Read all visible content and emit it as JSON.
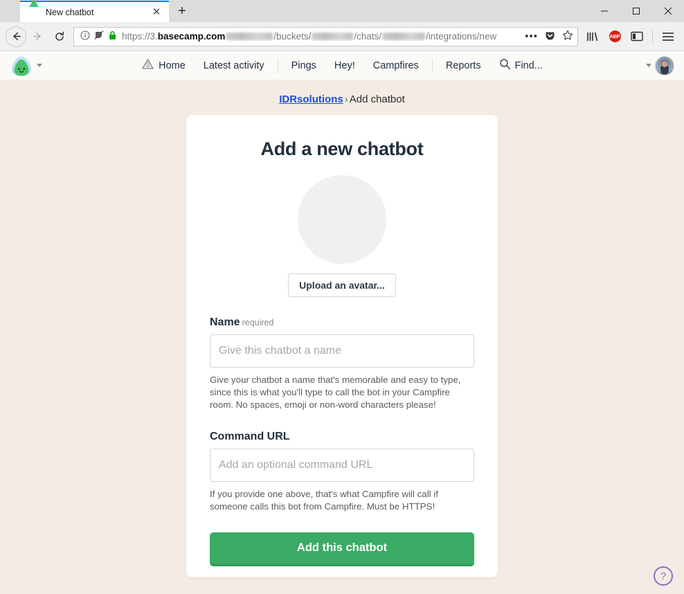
{
  "browser": {
    "tab": {
      "title": "New chatbot",
      "favicon": "basecamp-logo-icon",
      "close": "✕"
    },
    "new_tab_label": "+",
    "window_controls": {
      "minimize": "—",
      "maximize": "□",
      "close": "✕"
    },
    "nav": {
      "back": "←",
      "forward": "→",
      "reload": "↻"
    },
    "url": {
      "scheme": "https://3.",
      "domain": "basecamp.com",
      "path_1": "/buckets/",
      "path_2": "/chats/",
      "path_3": "/integrations/new",
      "icons": [
        "info-icon",
        "tracking-protection-icon",
        "lock-icon"
      ],
      "page_actions": "•••",
      "pocket": "pocket-icon",
      "bookmark": "star-icon"
    },
    "toolbar_icons": [
      "library-icon",
      "adblock-plus-icon",
      "sidebar-icon",
      "menu-icon"
    ],
    "adblock_label": "ABP"
  },
  "appnav": {
    "logo": "basecamp-logo-icon",
    "links": [
      {
        "label": "Home",
        "icon": "home-icon"
      },
      {
        "label": "Latest activity",
        "icon": ""
      },
      {
        "label": "Pings",
        "icon": ""
      },
      {
        "label": "Hey!",
        "icon": ""
      },
      {
        "label": "Campfires",
        "icon": ""
      },
      {
        "label": "Reports",
        "icon": ""
      },
      {
        "label": "Find...",
        "icon": "search-icon"
      }
    ],
    "account_avatar": "user-avatar"
  },
  "breadcrumb": {
    "project": "IDRsolutions",
    "separator": "›",
    "current": "Add chatbot"
  },
  "form": {
    "title": "Add a new chatbot",
    "avatar_placeholder": "empty-avatar",
    "upload_label": "Upload an avatar...",
    "fields": [
      {
        "label": "Name",
        "required_note": "required",
        "value": "",
        "placeholder": "Give this chatbot a name",
        "help": "Give your chatbot a name that's memorable and easy to type, since this is what you'll type to call the bot in your Campfire room. No spaces, emoji or non-word characters please!"
      },
      {
        "label": "Command URL",
        "required_note": "",
        "value": "",
        "placeholder": "Add an optional command URL",
        "help": "If you provide one above, that's what Campfire will call if someone calls this bot from Campfire. Must be HTTPS!"
      }
    ],
    "submit_label": "Add this chatbot"
  },
  "help_fab": {
    "label": "?"
  },
  "colors": {
    "page_background": "#f4ece4",
    "card_background": "#ffffff",
    "accent_green": "#3bab65",
    "link_blue": "#1d4ed8",
    "help_purple": "#8b6fc7",
    "tab_active_border": "#0a84ff",
    "adblock_red": "#d81f12"
  }
}
